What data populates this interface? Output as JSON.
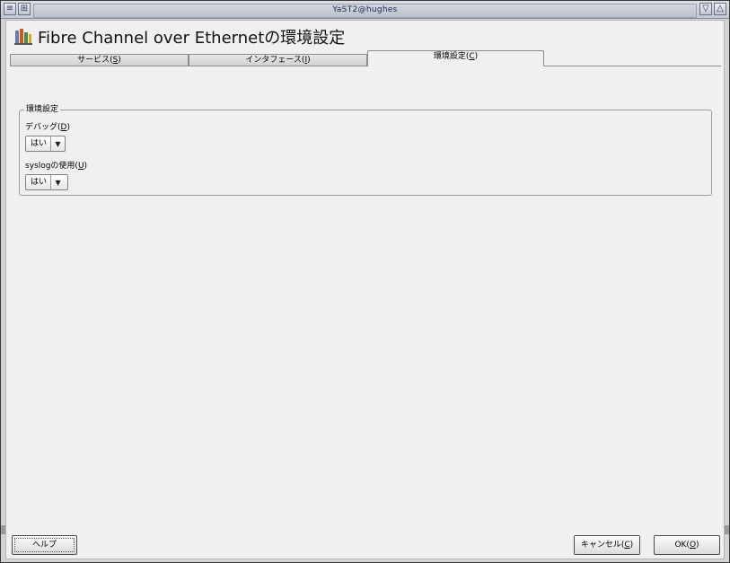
{
  "window": {
    "title": "YaST2@hughes"
  },
  "heading": {
    "title": "Fibre Channel over Ethernetの環境設定",
    "icon": "fcoe-config-icon"
  },
  "tabs": [
    {
      "label": "サービス(",
      "mnemonic": "S",
      "suffix": ")",
      "active": false
    },
    {
      "label": "インタフェース(",
      "mnemonic": "I",
      "suffix": ")",
      "active": false
    },
    {
      "label": "環境設定(",
      "mnemonic": "C",
      "suffix": ")",
      "active": true
    }
  ],
  "config_group": {
    "legend": "環境設定",
    "debug": {
      "label": "デバッグ(",
      "mnemonic": "D",
      "suffix": ")",
      "value": "はい"
    },
    "syslog": {
      "label": "syslogの使用(",
      "mnemonic": "U",
      "suffix": ")",
      "value": "はい"
    }
  },
  "buttons": {
    "help": "ヘルプ",
    "cancel": {
      "label": "キャンセル(",
      "mnemonic": "C",
      "suffix": ")"
    },
    "ok": {
      "label": "OK(",
      "mnemonic": "O",
      "suffix": ")"
    }
  },
  "colors": {
    "titlebar_text": "#1a2a55",
    "client_background": "#f0f0f0"
  }
}
